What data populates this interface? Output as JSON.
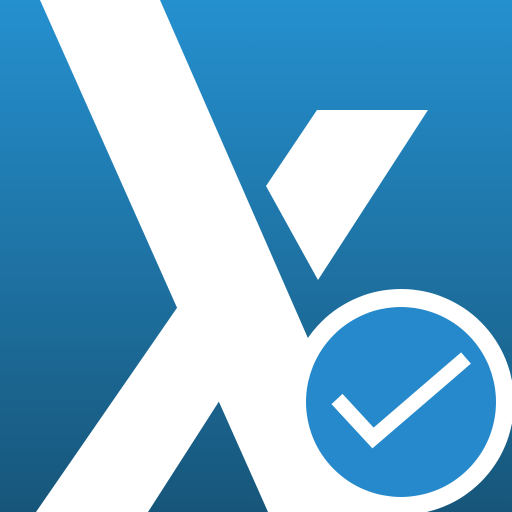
{
  "icon": {
    "logo_mark": "x-logo-icon",
    "badge": "check-badge-icon",
    "colors": {
      "background_top": "#2590CF",
      "background_bottom": "#17567A",
      "logo_fill": "#FFFFFF",
      "badge_ring": "#FFFFFF",
      "badge_fill": "#2689CB",
      "checkmark": "#FFFFFF"
    }
  }
}
